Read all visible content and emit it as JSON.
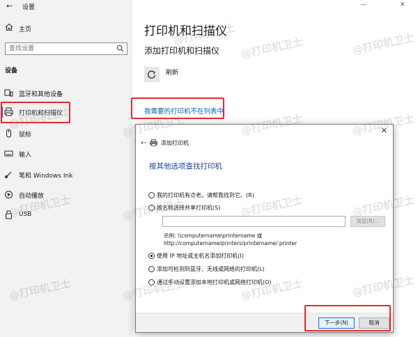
{
  "window": {
    "title": "设置",
    "min_glyph": "—",
    "close_glyph": "✕"
  },
  "sidebar": {
    "home_label": "主页",
    "search_placeholder": "查找设置",
    "section_heading": "设备",
    "items": [
      {
        "label": "蓝牙和其他设备",
        "icon": "bluetooth-devices-icon"
      },
      {
        "label": "打印机和扫描仪",
        "icon": "printer-icon",
        "active": true
      },
      {
        "label": "鼠标",
        "icon": "mouse-icon"
      },
      {
        "label": "输入",
        "icon": "keyboard-icon"
      },
      {
        "label": "笔和 Windows Ink",
        "icon": "pen-icon"
      },
      {
        "label": "自动播放",
        "icon": "autoplay-icon"
      },
      {
        "label": "USB",
        "icon": "usb-icon"
      }
    ]
  },
  "main": {
    "title": "打印机和扫描仪",
    "subtitle": "添加打印机和扫描仪",
    "refresh_label": "刷新",
    "printer_not_listed_link": "我需要的打印机不在列表中"
  },
  "dialog": {
    "title": "添加打印机",
    "heading": "按其他选项查找打印机",
    "options": [
      {
        "label": "我的打印机有点老。请帮我找到它。(R)",
        "selected": false
      },
      {
        "label": "按名称选择共享打印机(S)",
        "selected": false
      },
      {
        "label": "使用 IP 地址或主机名添加打印机(I)",
        "selected": true
      },
      {
        "label": "添加可检测到蓝牙、无线或网络的打印机(L)",
        "selected": false
      },
      {
        "label": "通过手动设置添加本地打印机或网络打印机(O)",
        "selected": false
      }
    ],
    "browse_label": "浏览(R)...",
    "example_line1": "示例: \\\\computername\\printername 或",
    "example_line2": "http://computername/printers/printername/.printer",
    "next_label": "下一步(N)",
    "cancel_label": "取消",
    "close_glyph": "✕",
    "back_glyph": "←"
  },
  "watermark": "@打印机卫士",
  "colors": {
    "accent": "#0067c0",
    "link": "#0063b1",
    "highlight": "#e8282b",
    "heading": "#1f3f9e"
  }
}
